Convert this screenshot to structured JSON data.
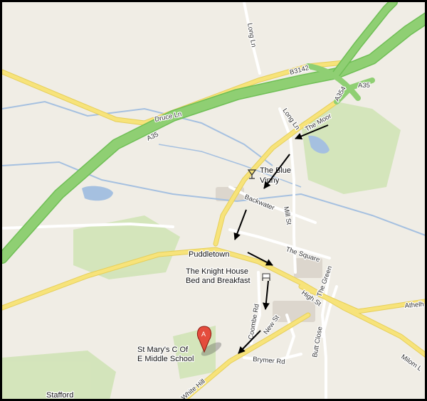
{
  "map": {
    "colors": {
      "land": "#f0ede5",
      "green": "#cfe3b4",
      "water": "#a5c0e0",
      "trunk_road": "#8fcf73",
      "main_road": "#f7e37a",
      "minor_road": "#ffffff",
      "building": "#dcd6cd",
      "arrow": "#000000",
      "marker": "#e44c3d"
    },
    "roads": {
      "a35": "A35",
      "a35_east": "A35",
      "a354": "A354",
      "b3142": "B3142",
      "druce_ln": "Druce Ln",
      "long_ln_north": "Long Ln",
      "long_ln": "Long Ln",
      "the_moor": "The Moor",
      "backwater": "Backwater",
      "mill_st": "Mill St",
      "the_square": "The Square",
      "high_st": "High St",
      "the_green": "The Green",
      "coombe_rd": "Coombe Rd",
      "new_st": "New St",
      "butt_close": "Butt Close",
      "brymer_rd": "Brymer Rd",
      "white_hill": "White Hill",
      "athelhampton": "Athelh",
      "milom_ln": "Milom L"
    },
    "places": {
      "puddletown": "Puddletown",
      "blue_vinny_line1": "The Blue",
      "blue_vinny_line2": "Vinny",
      "knight_house_line1": "The Knight House",
      "knight_house_line2": "Bed and Breakfast",
      "school_line1": "St Mary's C Of",
      "school_line2": "E Middle School",
      "stafford": "Stafford"
    },
    "marker": {
      "label": "A",
      "icon": "map-pin-icon"
    },
    "route_arrows": 7
  }
}
